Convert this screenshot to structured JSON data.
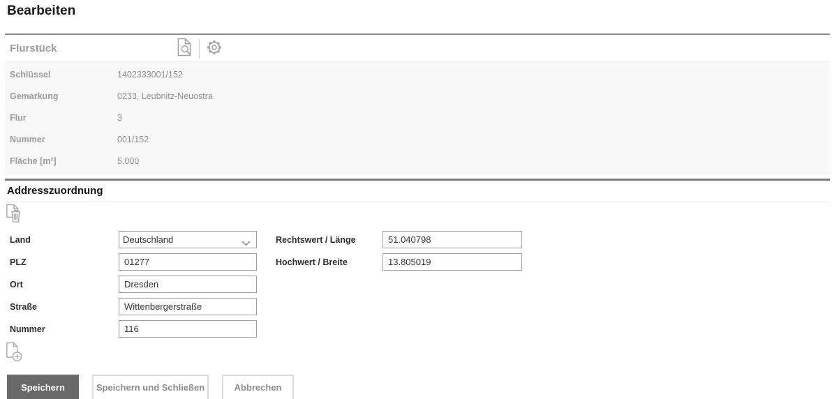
{
  "page": {
    "title": "Bearbeiten"
  },
  "flurstueck": {
    "section_title": "Flurstück",
    "toolbar": {
      "preview_icon": "document-search-icon",
      "settings_icon": "gear-icon"
    },
    "fields": [
      {
        "label": "Schlüssel",
        "value": "1402333001/152"
      },
      {
        "label": "Gemarkung",
        "value": "0233, Leubnitz-Neuostra"
      },
      {
        "label": "Flur",
        "value": "3"
      },
      {
        "label": "Nummer",
        "value": "001/152"
      },
      {
        "label": "Fläche [m²]",
        "value": "5.000"
      }
    ]
  },
  "addresszuordnung": {
    "section_title": "Addresszuordnung",
    "toolbar": {
      "delete_icon": "document-delete-icon",
      "add_icon": "document-add-icon"
    },
    "form": {
      "land": {
        "label": "Land",
        "value": "Deutschland"
      },
      "plz": {
        "label": "PLZ",
        "value": "01277"
      },
      "ort": {
        "label": "Ort",
        "value": "Dresden"
      },
      "strasse": {
        "label": "Straße",
        "value": "Wittenbergerstraße"
      },
      "nummer": {
        "label": "Nummer",
        "value": "116"
      },
      "rechtswert": {
        "label": "Rechtswert / Länge",
        "value": "51.040798"
      },
      "hochwert": {
        "label": "Hochwert / Breite",
        "value": "13.805019"
      }
    },
    "select_chevron_icon": "chevron-down-icon"
  },
  "buttons": {
    "save": "Speichern",
    "save_close": "Speichern und Schließen",
    "cancel": "Abbrechen"
  },
  "colors": {
    "primary_button_bg": "#696969",
    "primary_button_text": "#ffffff",
    "secondary_button_text": "#8c8c8c",
    "secondary_button_border": "#dcdcdc",
    "section_divider": "#8a8a8a",
    "readonly_panel_bg": "#f8f8f8",
    "muted_label": "#9b9b9b",
    "icon_gray": "#a3a3a3",
    "input_border": "#9e9e9e"
  }
}
